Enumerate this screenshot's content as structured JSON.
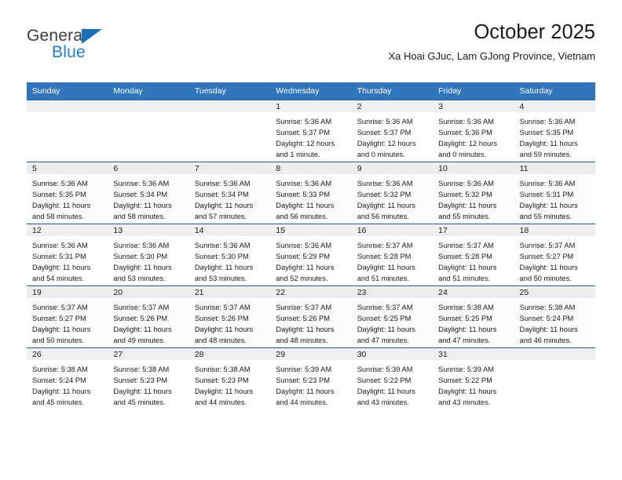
{
  "brand": {
    "name_top": "General",
    "name_bottom": "Blue",
    "accent_color": "#1d7fd0",
    "triangle_color": "#1d6fb8"
  },
  "header": {
    "title": "October 2025",
    "subtitle": "Xa Hoai GJuc, Lam GJong Province, Vietnam"
  },
  "theme": {
    "header_row_bg": "#3176bc",
    "row_divider": "#2a6099",
    "daynum_strip_bg": "#efefef",
    "text_color": "#1a1a1a"
  },
  "calendar": {
    "weekday_headers": [
      "Sunday",
      "Monday",
      "Tuesday",
      "Wednesday",
      "Thursday",
      "Friday",
      "Saturday"
    ],
    "labels": {
      "sunrise": "Sunrise:",
      "sunset": "Sunset:",
      "daylight": "Daylight:"
    },
    "weeks": [
      [
        {
          "day": "",
          "empty": true
        },
        {
          "day": "",
          "empty": true
        },
        {
          "day": "",
          "empty": true
        },
        {
          "day": "1",
          "sunrise": "Sunrise: 5:36 AM",
          "sunset": "Sunset: 5:37 PM",
          "daylight1": "Daylight: 12 hours",
          "daylight2": "and 1 minute."
        },
        {
          "day": "2",
          "sunrise": "Sunrise: 5:36 AM",
          "sunset": "Sunset: 5:37 PM",
          "daylight1": "Daylight: 12 hours",
          "daylight2": "and 0 minutes."
        },
        {
          "day": "3",
          "sunrise": "Sunrise: 5:36 AM",
          "sunset": "Sunset: 5:36 PM",
          "daylight1": "Daylight: 12 hours",
          "daylight2": "and 0 minutes."
        },
        {
          "day": "4",
          "sunrise": "Sunrise: 5:36 AM",
          "sunset": "Sunset: 5:35 PM",
          "daylight1": "Daylight: 11 hours",
          "daylight2": "and 59 minutes."
        }
      ],
      [
        {
          "day": "5",
          "sunrise": "Sunrise: 5:36 AM",
          "sunset": "Sunset: 5:35 PM",
          "daylight1": "Daylight: 11 hours",
          "daylight2": "and 58 minutes."
        },
        {
          "day": "6",
          "sunrise": "Sunrise: 5:36 AM",
          "sunset": "Sunset: 5:34 PM",
          "daylight1": "Daylight: 11 hours",
          "daylight2": "and 58 minutes."
        },
        {
          "day": "7",
          "sunrise": "Sunrise: 5:36 AM",
          "sunset": "Sunset: 5:34 PM",
          "daylight1": "Daylight: 11 hours",
          "daylight2": "and 57 minutes."
        },
        {
          "day": "8",
          "sunrise": "Sunrise: 5:36 AM",
          "sunset": "Sunset: 5:33 PM",
          "daylight1": "Daylight: 11 hours",
          "daylight2": "and 56 minutes."
        },
        {
          "day": "9",
          "sunrise": "Sunrise: 5:36 AM",
          "sunset": "Sunset: 5:32 PM",
          "daylight1": "Daylight: 11 hours",
          "daylight2": "and 56 minutes."
        },
        {
          "day": "10",
          "sunrise": "Sunrise: 5:36 AM",
          "sunset": "Sunset: 5:32 PM",
          "daylight1": "Daylight: 11 hours",
          "daylight2": "and 55 minutes."
        },
        {
          "day": "11",
          "sunrise": "Sunrise: 5:36 AM",
          "sunset": "Sunset: 5:31 PM",
          "daylight1": "Daylight: 11 hours",
          "daylight2": "and 55 minutes."
        }
      ],
      [
        {
          "day": "12",
          "sunrise": "Sunrise: 5:36 AM",
          "sunset": "Sunset: 5:31 PM",
          "daylight1": "Daylight: 11 hours",
          "daylight2": "and 54 minutes."
        },
        {
          "day": "13",
          "sunrise": "Sunrise: 5:36 AM",
          "sunset": "Sunset: 5:30 PM",
          "daylight1": "Daylight: 11 hours",
          "daylight2": "and 53 minutes."
        },
        {
          "day": "14",
          "sunrise": "Sunrise: 5:36 AM",
          "sunset": "Sunset: 5:30 PM",
          "daylight1": "Daylight: 11 hours",
          "daylight2": "and 53 minutes."
        },
        {
          "day": "15",
          "sunrise": "Sunrise: 5:36 AM",
          "sunset": "Sunset: 5:29 PM",
          "daylight1": "Daylight: 11 hours",
          "daylight2": "and 52 minutes."
        },
        {
          "day": "16",
          "sunrise": "Sunrise: 5:37 AM",
          "sunset": "Sunset: 5:28 PM",
          "daylight1": "Daylight: 11 hours",
          "daylight2": "and 51 minutes."
        },
        {
          "day": "17",
          "sunrise": "Sunrise: 5:37 AM",
          "sunset": "Sunset: 5:28 PM",
          "daylight1": "Daylight: 11 hours",
          "daylight2": "and 51 minutes."
        },
        {
          "day": "18",
          "sunrise": "Sunrise: 5:37 AM",
          "sunset": "Sunset: 5:27 PM",
          "daylight1": "Daylight: 11 hours",
          "daylight2": "and 50 minutes."
        }
      ],
      [
        {
          "day": "19",
          "sunrise": "Sunrise: 5:37 AM",
          "sunset": "Sunset: 5:27 PM",
          "daylight1": "Daylight: 11 hours",
          "daylight2": "and 50 minutes."
        },
        {
          "day": "20",
          "sunrise": "Sunrise: 5:37 AM",
          "sunset": "Sunset: 5:26 PM",
          "daylight1": "Daylight: 11 hours",
          "daylight2": "and 49 minutes."
        },
        {
          "day": "21",
          "sunrise": "Sunrise: 5:37 AM",
          "sunset": "Sunset: 5:26 PM",
          "daylight1": "Daylight: 11 hours",
          "daylight2": "and 48 minutes."
        },
        {
          "day": "22",
          "sunrise": "Sunrise: 5:37 AM",
          "sunset": "Sunset: 5:26 PM",
          "daylight1": "Daylight: 11 hours",
          "daylight2": "and 48 minutes."
        },
        {
          "day": "23",
          "sunrise": "Sunrise: 5:37 AM",
          "sunset": "Sunset: 5:25 PM",
          "daylight1": "Daylight: 11 hours",
          "daylight2": "and 47 minutes."
        },
        {
          "day": "24",
          "sunrise": "Sunrise: 5:38 AM",
          "sunset": "Sunset: 5:25 PM",
          "daylight1": "Daylight: 11 hours",
          "daylight2": "and 47 minutes."
        },
        {
          "day": "25",
          "sunrise": "Sunrise: 5:38 AM",
          "sunset": "Sunset: 5:24 PM",
          "daylight1": "Daylight: 11 hours",
          "daylight2": "and 46 minutes."
        }
      ],
      [
        {
          "day": "26",
          "sunrise": "Sunrise: 5:38 AM",
          "sunset": "Sunset: 5:24 PM",
          "daylight1": "Daylight: 11 hours",
          "daylight2": "and 45 minutes."
        },
        {
          "day": "27",
          "sunrise": "Sunrise: 5:38 AM",
          "sunset": "Sunset: 5:23 PM",
          "daylight1": "Daylight: 11 hours",
          "daylight2": "and 45 minutes."
        },
        {
          "day": "28",
          "sunrise": "Sunrise: 5:38 AM",
          "sunset": "Sunset: 5:23 PM",
          "daylight1": "Daylight: 11 hours",
          "daylight2": "and 44 minutes."
        },
        {
          "day": "29",
          "sunrise": "Sunrise: 5:39 AM",
          "sunset": "Sunset: 5:23 PM",
          "daylight1": "Daylight: 11 hours",
          "daylight2": "and 44 minutes."
        },
        {
          "day": "30",
          "sunrise": "Sunrise: 5:39 AM",
          "sunset": "Sunset: 5:22 PM",
          "daylight1": "Daylight: 11 hours",
          "daylight2": "and 43 minutes."
        },
        {
          "day": "31",
          "sunrise": "Sunrise: 5:39 AM",
          "sunset": "Sunset: 5:22 PM",
          "daylight1": "Daylight: 11 hours",
          "daylight2": "and 43 minutes."
        },
        {
          "day": "",
          "empty": true
        }
      ]
    ]
  }
}
